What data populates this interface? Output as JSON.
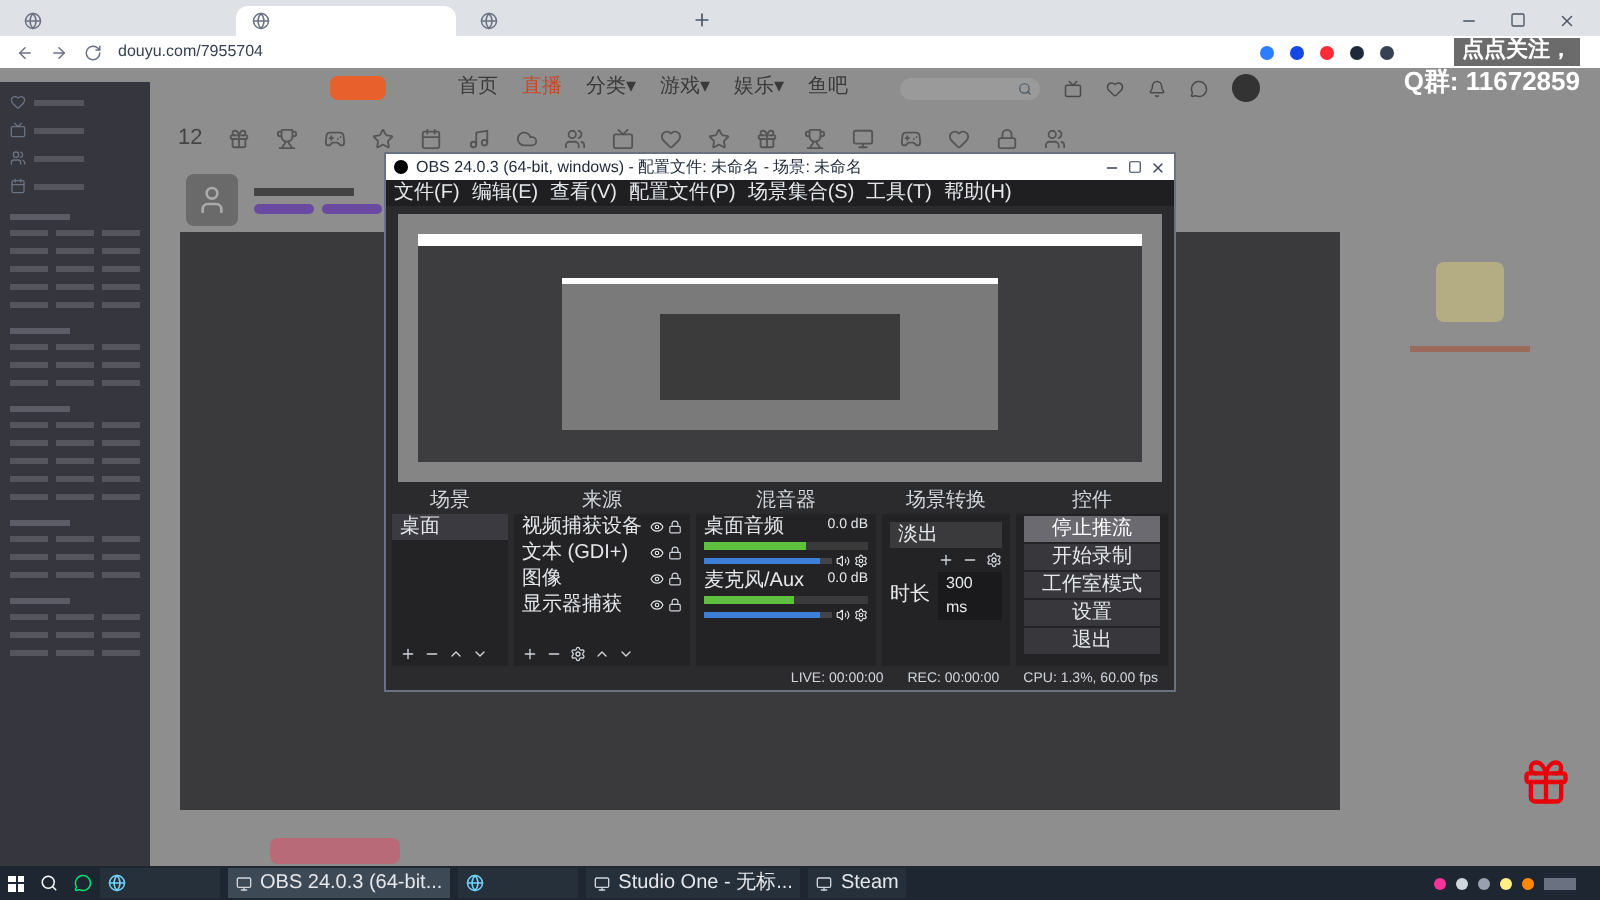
{
  "browser": {
    "tabs": [
      {
        "selected": false
      },
      {
        "selected": true
      },
      {
        "selected": false
      }
    ],
    "url": "douyu.com/7955704"
  },
  "site": {
    "nav": [
      {
        "label": "首页",
        "selected": false
      },
      {
        "label": "直播",
        "selected": true
      },
      {
        "label": "分类▾",
        "selected": false
      },
      {
        "label": "游戏▾",
        "selected": false
      },
      {
        "label": "娱乐▾",
        "selected": false
      },
      {
        "label": "鱼吧",
        "selected": false
      }
    ],
    "follow_count": "12"
  },
  "overlay": {
    "line_1": "点点关注，",
    "line_2": "Q群: 11672859"
  },
  "obs": {
    "title": "OBS 24.0.3 (64-bit, windows) - 配置文件: 未命名 - 场景: 未命名",
    "menu": [
      "文件(F)",
      "编辑(E)",
      "查看(V)",
      "配置文件(P)",
      "场景集合(S)",
      "工具(T)",
      "帮助(H)"
    ],
    "docks": {
      "scenes": "场景",
      "sources": "来源",
      "mixer": "混音器",
      "transitions": "场景转换",
      "controls": "控件"
    },
    "scenes": [
      {
        "label": "桌面",
        "selected": true
      }
    ],
    "sources": [
      {
        "label": "视频捕获设备",
        "visible": true
      },
      {
        "label": "文本 (GDI+)",
        "visible": true
      },
      {
        "label": "图像",
        "visible": true
      },
      {
        "label": "显示器捕获",
        "visible": true
      }
    ],
    "mixer": [
      {
        "name": "桌面音频",
        "reading": "0.0 dB",
        "meter": {
          "level": 0.62
        },
        "volume": {
          "level": 0.9
        }
      },
      {
        "name": "麦克风/Aux",
        "reading": "0.0 dB",
        "meter": {
          "level": 0.55
        },
        "volume": {
          "level": 0.9
        }
      }
    ],
    "transition": {
      "value": "淡出",
      "duration_label": "时长",
      "duration": "300 ms"
    },
    "controls": [
      {
        "label": "停止推流",
        "highlighted": true
      },
      {
        "label": "开始录制",
        "highlighted": false
      },
      {
        "label": "工作室模式",
        "highlighted": false
      },
      {
        "label": "设置",
        "highlighted": false
      },
      {
        "label": "退出",
        "highlighted": false
      }
    ],
    "status": [
      "LIVE: 00:00:00",
      "REC: 00:00:00",
      "CPU: 1.3%, 60.00 fps"
    ]
  },
  "taskbar": [
    {
      "kind": "icon",
      "selected": false
    },
    {
      "kind": "app",
      "label": "OBS 24.0.3 (64-bit...",
      "selected": true
    },
    {
      "kind": "icon",
      "selected": false
    },
    {
      "kind": "app",
      "label": "Studio One - 无标...",
      "selected": false
    },
    {
      "kind": "app",
      "label": "Steam",
      "selected": false
    }
  ]
}
